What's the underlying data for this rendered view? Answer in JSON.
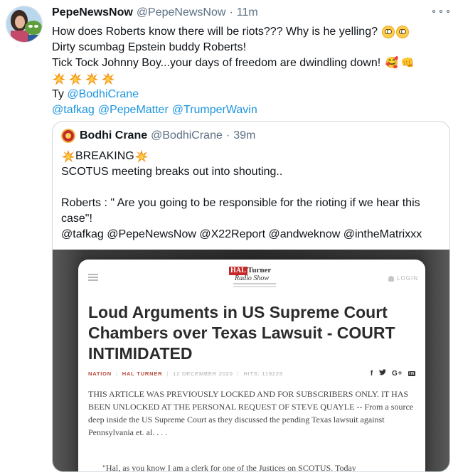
{
  "tweet": {
    "display_name": "PepeNewsNow",
    "handle": "@PepeNewsNow",
    "separator": "·",
    "time": "11m",
    "lines": {
      "line1": "How does Roberts know there will be riots???  Why is he yelling?",
      "line2": "Dirty scumbag Epstein buddy Roberts!",
      "line3": "Tick Tock Johnny Boy...your days of freedom are dwindling down!",
      "ty_prefix": "Ty ",
      "mention_bodhi": "@BodhiCrane",
      "mention_tafkag": "@tafkag",
      "mention_pepematter": "@PepeMatter",
      "mention_trumper": "@TrumperWavin"
    },
    "emoji": {
      "flushed": "flushed-face-emoji",
      "smiling_hearts": "🥰",
      "fist": "👊",
      "collision": "collision-emoji"
    }
  },
  "quote": {
    "display_name": "Bodhi Crane",
    "handle": "@BodhiCrane",
    "separator": "·",
    "time": "39m",
    "breaking": "BREAKING",
    "line2": "SCOTUS meeting breaks out into shouting..",
    "line3a": "Roberts : \" Are you going to be responsible for the rioting if we hear this",
    "line3b": "case\"!",
    "mentions": "@tafkag @PepeNewsNow @X22Report @andweknow @intheMatrixxx"
  },
  "article": {
    "logo_hal": "HAL",
    "logo_turner": "Turner",
    "logo_radio": "Radio Show",
    "login": "LOGIN",
    "headline": "Loud Arguments in US Supreme Court Chambers over Texas Lawsuit - COURT INTIMIDATED",
    "category": "NATION",
    "author": "HAL TURNER",
    "date": "12 DECEMBER 2020",
    "hits": "HITS: 119229",
    "share": {
      "facebook": "f",
      "googleplus": "G+",
      "linkedin": "in"
    },
    "body": "THIS ARTICLE WAS PREVIOUSLY LOCKED AND FOR SUBSCRIBERS ONLY.  IT HAS BEEN UNLOCKED AT THE PERSONAL REQUEST OF STEVE QUAYLE -- From a source deep inside the US Supreme Court as they discussed the pending Texas lawsuit against Pennsylvania et. al. . . .",
    "quote_line": "\"Hal, as you know I am a clerk for one of the Justices on SCOTUS. Today"
  },
  "colors": {
    "link": "#1b95e0",
    "muted": "#5b7083",
    "text": "#0f1419",
    "border": "#cfd9de"
  }
}
